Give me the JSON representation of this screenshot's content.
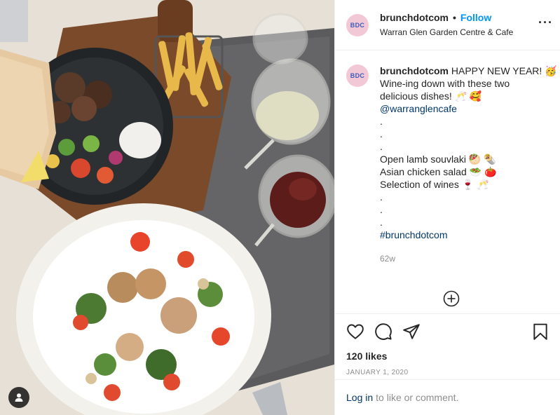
{
  "post": {
    "username": "brunchdotcom",
    "avatar_text": "BDC",
    "follow_label": "Follow",
    "separator": "•",
    "location": "Warran Glen Garden Centre & Cafe",
    "more_icon": "ellipsis-icon"
  },
  "caption": {
    "username": "brunchdotcom",
    "lines": [
      "HAPPY NEW YEAR! 🥳",
      "Wine-ing down with these two",
      "delicious dishes! 🥂 🥰",
      "@warranglencafe",
      ".",
      ".",
      ".",
      "Open lamb souvlaki 🥙 🌯",
      "Asian chicken salad 🥗 🍅",
      "Selection of wines 🍷 🥂",
      ".",
      ".",
      ".",
      "#brunchdotcom"
    ],
    "age": "62w"
  },
  "actions": {
    "like_icon": "heart-icon",
    "comment_icon": "comment-icon",
    "share_icon": "paper-plane-icon",
    "save_icon": "bookmark-icon",
    "add_icon": "plus-circle-icon"
  },
  "likes": "120 likes",
  "date": "January 1, 2020",
  "login": {
    "link": "Log in",
    "text": "to like or comment."
  },
  "colors": {
    "accent": "#0095f6",
    "link": "#00376b",
    "muted": "#8e8e8e"
  }
}
